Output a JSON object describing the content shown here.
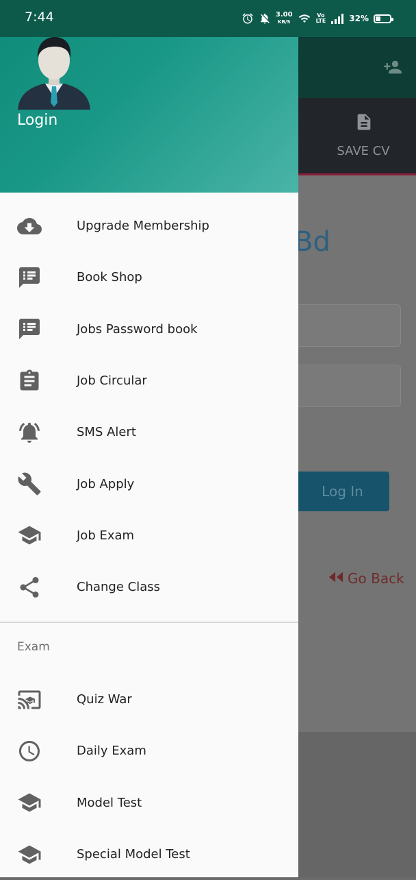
{
  "status_bar": {
    "time": "7:44",
    "speed_value": "3.00",
    "speed_unit": "KB/S",
    "volte_top": "Vo",
    "volte_bottom": "LTE",
    "battery_percent": "32%",
    "battery_level": 0.32,
    "icons": [
      "alarm-icon",
      "mute-icon",
      "wifi-icon",
      "signal-icon",
      "battery-icon"
    ]
  },
  "drawer": {
    "header": {
      "login_label": "Login"
    },
    "main_menu": [
      {
        "label": "Upgrade Membership",
        "icon": "cloud-download-icon"
      },
      {
        "label": "Book Shop",
        "icon": "message-list-icon"
      },
      {
        "label": "Jobs Password book",
        "icon": "message-list-icon"
      },
      {
        "label": "Job Circular",
        "icon": "clipboard-icon"
      },
      {
        "label": "SMS Alert",
        "icon": "bell-ring-icon"
      },
      {
        "label": "Job Apply",
        "icon": "wrench-icon"
      },
      {
        "label": "Job Exam",
        "icon": "graduation-cap-icon"
      },
      {
        "label": "Change Class",
        "icon": "share-icon"
      }
    ],
    "section_title": "Exam",
    "exam_menu": [
      {
        "label": "Quiz War",
        "icon": "cast-education-icon"
      },
      {
        "label": "Daily Exam",
        "icon": "clock-icon"
      },
      {
        "label": "Model Test",
        "icon": "graduation-cap-icon"
      },
      {
        "label": "Special Model Test",
        "icon": "graduation-cap-icon"
      }
    ]
  },
  "background": {
    "tab_save_cv": "SAVE CV",
    "brand_partial": "Bd",
    "login_button": "Log In",
    "go_back": "Go Back"
  },
  "colors": {
    "drawer_header_start": "#0f8a78",
    "drawer_header_end": "#4ab4a8",
    "status_bar": "#0d5a4b",
    "icon_gray": "#616161"
  }
}
